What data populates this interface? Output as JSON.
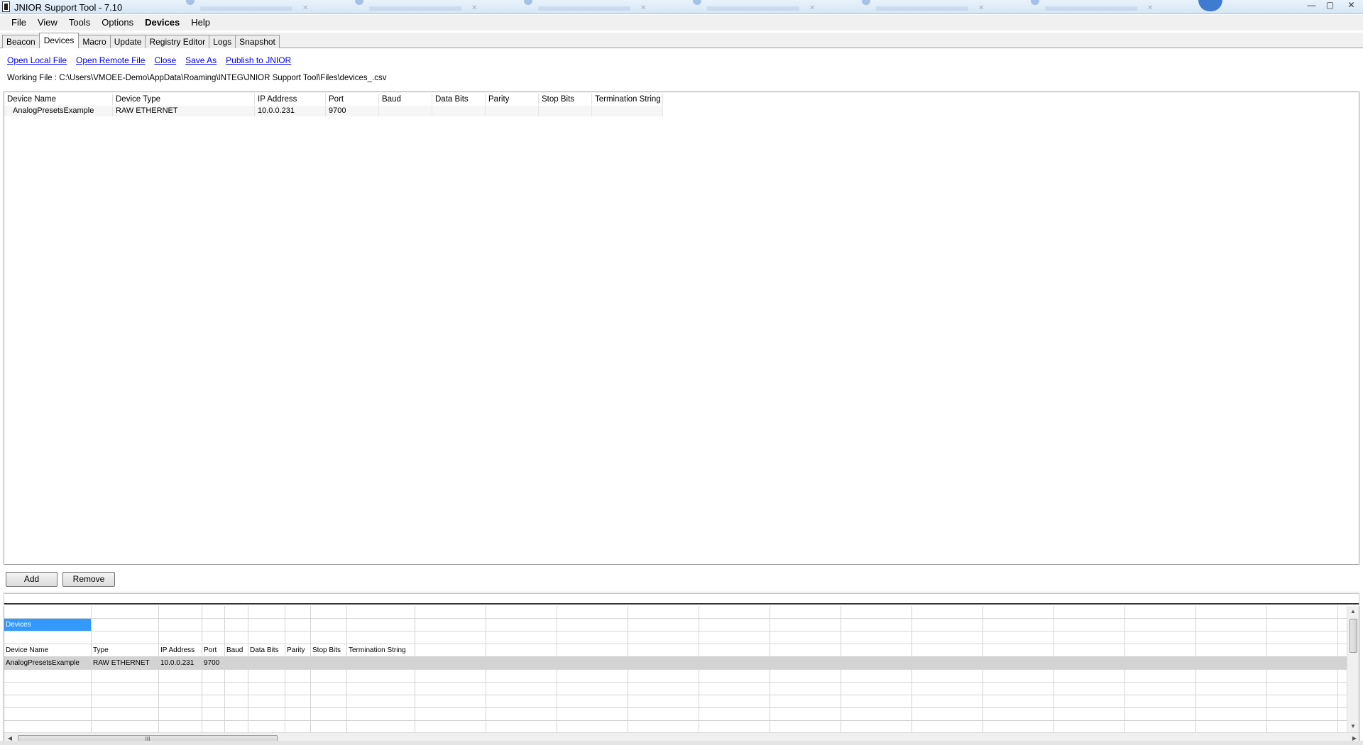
{
  "window": {
    "title": "JNIOR Support Tool - 7.10",
    "controls": [
      "—",
      "▢",
      "✕"
    ]
  },
  "menu": [
    {
      "label": "File",
      "bold": false
    },
    {
      "label": "View",
      "bold": false
    },
    {
      "label": "Tools",
      "bold": false
    },
    {
      "label": "Options",
      "bold": false
    },
    {
      "label": "Devices",
      "bold": true
    },
    {
      "label": "Help",
      "bold": false
    }
  ],
  "tabs": [
    {
      "label": "Beacon",
      "active": false
    },
    {
      "label": "Devices",
      "active": true
    },
    {
      "label": "Macro",
      "active": false
    },
    {
      "label": "Update",
      "active": false
    },
    {
      "label": "Registry Editor",
      "active": false
    },
    {
      "label": "Logs",
      "active": false
    },
    {
      "label": "Snapshot",
      "active": false
    }
  ],
  "file_links": [
    "Open Local File",
    "Open Remote File",
    "Close",
    "Save As",
    "Publish to JNIOR"
  ],
  "working_file": "Working File : C:\\Users\\VMOEE-Demo\\AppData\\Roaming\\INTEG\\JNIOR Support Tool\\Files\\devices_.csv",
  "device_table": {
    "columns": [
      "Device Name",
      "Device Type",
      "IP Address",
      "Port",
      "Baud",
      "Data Bits",
      "Parity",
      "Stop Bits",
      "Termination String"
    ],
    "rows": [
      [
        "AnalogPresetsExample",
        "RAW ETHERNET",
        "10.0.0.231",
        "9700",
        "",
        "",
        "",
        "",
        ""
      ]
    ]
  },
  "buttons": {
    "add": "Add",
    "remove": "Remove"
  },
  "sheet": {
    "title": "Devices",
    "columns": [
      "Device Name",
      "Type",
      "IP Address",
      "Port",
      "Baud",
      "Data Bits",
      "Parity",
      "Stop Bits",
      "Termination String"
    ],
    "rows": [
      [
        "AnalogPresetsExample",
        "RAW ETHERNET",
        "10.0.0.231",
        "9700",
        "",
        "",
        "",
        "",
        ""
      ]
    ],
    "scroll_thumb_label": "III"
  },
  "colors": {
    "selection": "#3399ff",
    "link": "#0000ee",
    "row_highlight": "#d3d3d3"
  }
}
